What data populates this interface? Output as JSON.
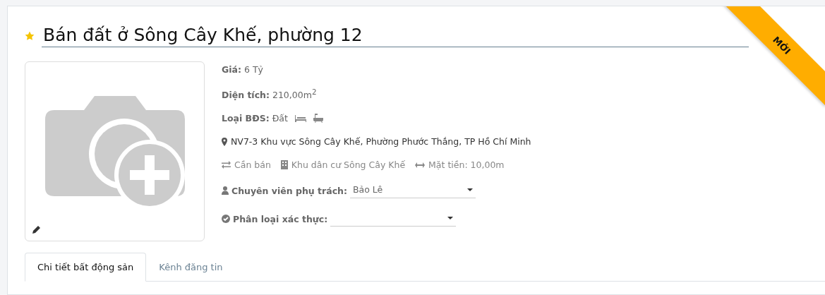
{
  "listing": {
    "title": "Bán đất ở Sông Cây Khế, phường 12",
    "favorite": true,
    "ribbon": "MỚI"
  },
  "facts": [
    {
      "label": "Giá:",
      "value": "6 Tỷ"
    },
    {
      "label": "Diện tích:",
      "value": "210,00m$^{2}$"
    },
    {
      "label": "Loại BĐS:",
      "value": "Đất"
    }
  ],
  "address": "NV7-3 Khu vực Sông Cây Khế, Phường Phước Thắng, TP Hồ Chí Minh",
  "attributes": [
    {
      "kind": "transaction",
      "text": "Cần bán"
    },
    {
      "kind": "project",
      "text": "Khu dân cư Sông Cây Khế"
    },
    {
      "kind": "frontage",
      "text": "Mặt tiền: 10,00m"
    }
  ],
  "selects": [
    {
      "kind": "person",
      "label": "Chuyên viên phụ trách:",
      "value": "Bảo Lê"
    },
    {
      "kind": "verify",
      "label": "Phân loại xác thực:"
    }
  ],
  "tabs": [
    {
      "label": "Chi tiết bất động sản",
      "selected": true
    },
    {
      "label": "Kênh đăng tin",
      "selected": false
    }
  ]
}
